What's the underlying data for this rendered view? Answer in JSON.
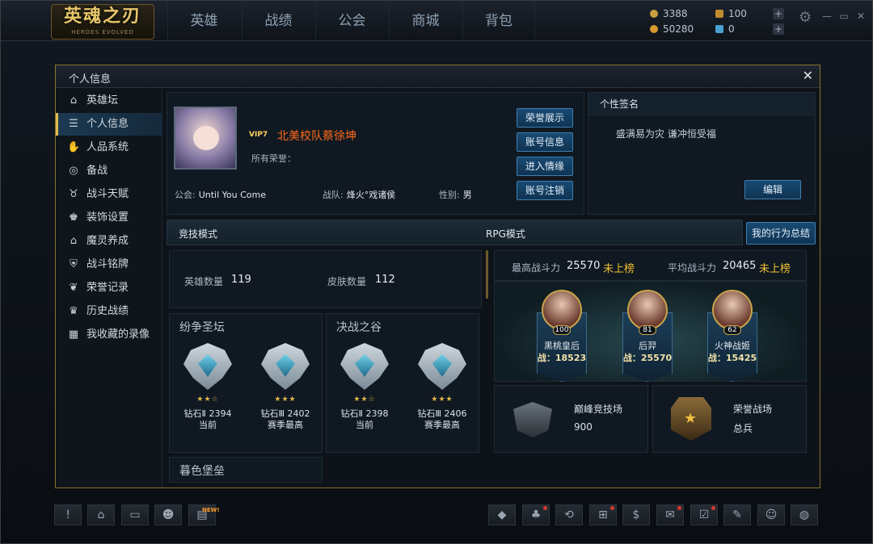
{
  "app": {
    "logo_text": "英魂之刃",
    "logo_sub": "HEROES EVOLVED"
  },
  "nav": {
    "tabs": [
      "英雄",
      "战绩",
      "公会",
      "商城",
      "背包"
    ]
  },
  "resources": {
    "gold": "3388",
    "diamond": "50280",
    "food": "100",
    "gem": "0"
  },
  "dialog": {
    "title": "个人信息",
    "close": "✕"
  },
  "sidebar": {
    "items": [
      {
        "label": "英雄坛",
        "icon": "temple-icon"
      },
      {
        "label": "个人信息",
        "icon": "profile-list-icon"
      },
      {
        "label": "人品系统",
        "icon": "hands-icon"
      },
      {
        "label": "备战",
        "icon": "globe-icon"
      },
      {
        "label": "战斗天赋",
        "icon": "horns-icon"
      },
      {
        "label": "装饰设置",
        "icon": "trophy-person-icon"
      },
      {
        "label": "魔灵养成",
        "icon": "temple-icon"
      },
      {
        "label": "战斗铭牌",
        "icon": "badge-icon"
      },
      {
        "label": "荣誉记录",
        "icon": "laurel-icon"
      },
      {
        "label": "历史战绩",
        "icon": "cup-icon"
      },
      {
        "label": "我收藏的录像",
        "icon": "film-icon"
      }
    ]
  },
  "profile": {
    "vip": "VIP7",
    "name": "北美校队蔡徐坤",
    "honor_label": "所有荣誉：",
    "guild_label": "公会:",
    "guild_value": "Until You Come",
    "team_label": "战队:",
    "team_value": "烽火°戏诸侯",
    "gender_label": "性别:",
    "gender_value": "男",
    "buttons": [
      "荣誉展示",
      "账号信息",
      "进入情缘",
      "账号注销"
    ]
  },
  "signature": {
    "title": "个性签名",
    "text": "盛满易为灾  谦冲恒受福",
    "edit": "编辑"
  },
  "modes": {
    "arena": "竞技模式",
    "rpg": "RPG模式",
    "summary": "我的行为总结"
  },
  "counts": {
    "hero_label": "英雄数量",
    "hero_value": "119",
    "skin_label": "皮肤数量",
    "skin_value": "112"
  },
  "rank_sections": [
    {
      "title": "纷争圣坛",
      "ranks": [
        {
          "stars": 2,
          "tier": "钻石Ⅱ 2394",
          "note": "当前"
        },
        {
          "stars": 3,
          "tier": "钻石Ⅲ 2402",
          "note": "赛季最高"
        }
      ]
    },
    {
      "title": "决战之谷",
      "ranks": [
        {
          "stars": 2,
          "tier": "钻石Ⅱ 2398",
          "note": "当前"
        },
        {
          "stars": 3,
          "tier": "钻石Ⅲ 2406",
          "note": "赛季最高"
        }
      ]
    }
  ],
  "next_section": "暮色堡垒",
  "power": {
    "max_label": "最高战斗力",
    "max_value": "25570",
    "max_status": "未上榜",
    "avg_label": "平均战斗力",
    "avg_value": "20465",
    "avg_status": "未上榜"
  },
  "heroes": [
    {
      "name": "黑桃皇后",
      "level": "100",
      "power": "战：18523"
    },
    {
      "name": "后羿",
      "level": "81",
      "power": "战：25570"
    },
    {
      "name": "火神战姬",
      "level": "62",
      "power": "战：15425"
    }
  ],
  "peak": {
    "title": "巅峰竞技场",
    "value": "900"
  },
  "honor_field": {
    "title": "荣誉战场",
    "value": "总兵"
  },
  "bottom_left": [
    {
      "icon": "alert-icon",
      "glyph": "!"
    },
    {
      "icon": "home-icon",
      "glyph": "⌂"
    },
    {
      "icon": "chat-icon",
      "glyph": "▭"
    },
    {
      "icon": "friends-icon",
      "glyph": "☻"
    },
    {
      "icon": "news-icon",
      "glyph": "▤",
      "badge": "NEW!"
    }
  ],
  "bottom_right": [
    {
      "icon": "diamond-icon",
      "glyph": "◆"
    },
    {
      "icon": "bell-icon",
      "glyph": "♣"
    },
    {
      "icon": "refresh-icon",
      "glyph": "⟲"
    },
    {
      "icon": "cart-icon",
      "glyph": "⊞"
    },
    {
      "icon": "money-bag-icon",
      "glyph": "$"
    },
    {
      "icon": "mail-icon",
      "glyph": "✉"
    },
    {
      "icon": "checklist-icon",
      "glyph": "☑"
    },
    {
      "icon": "edit-icon",
      "glyph": "✎"
    },
    {
      "icon": "support-icon",
      "glyph": "☺"
    },
    {
      "icon": "wechat-icon",
      "glyph": "◍"
    }
  ]
}
